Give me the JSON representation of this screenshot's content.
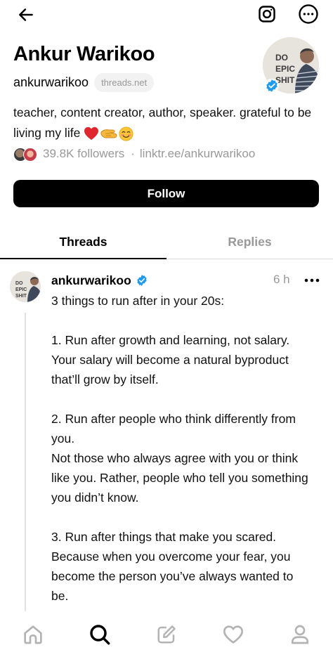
{
  "header": {
    "back_icon": "arrow-left-icon",
    "instagram_icon": "instagram-icon",
    "more_icon": "more-horizontal-icon"
  },
  "profile": {
    "name": "Ankur Warikoo",
    "handle": "ankurwarikoo",
    "domain": "threads.net",
    "avatar_text_lines": [
      "DO",
      "EPIC",
      "SHIT"
    ],
    "bio_text": "teacher, content creator, author, speaker. grateful to be living my life",
    "bio_emojis": [
      "❤️",
      "🫱",
      "☺️"
    ],
    "followers": "39.8K followers",
    "separator": "·",
    "link": "linktr.ee/ankurwarikoo",
    "follow_label": "Follow"
  },
  "tabs": [
    {
      "label": "Threads",
      "active": true
    },
    {
      "label": "Replies",
      "active": false
    }
  ],
  "post": {
    "author": "ankurwarikoo",
    "time": "6 h",
    "avatar_text_lines": [
      "DO",
      "EPIC",
      "SHIT"
    ],
    "lines": [
      "3 things to run after in your 20s:",
      "",
      "1. Run after growth and learning, not salary.",
      "Your salary will become a natural byproduct",
      "that’ll grow by itself.",
      "",
      "2. Run after people who think differently from",
      "you.",
      "Not those who always agree with you or think",
      "like you. Rather, people who tell you something",
      "you didn’t know.",
      "",
      "3. Run after things that make you scared.",
      "Because when you overcome your fear, you",
      "become the person you’ve always wanted to",
      "be."
    ]
  },
  "bottom_nav": [
    {
      "icon": "home-icon"
    },
    {
      "icon": "search-icon",
      "active": true
    },
    {
      "icon": "compose-icon"
    },
    {
      "icon": "heart-icon"
    },
    {
      "icon": "profile-icon"
    }
  ],
  "colors": {
    "primary": "#000000",
    "muted": "#999999",
    "verified": "#1d9bf0",
    "divider": "#d9d9d9"
  }
}
